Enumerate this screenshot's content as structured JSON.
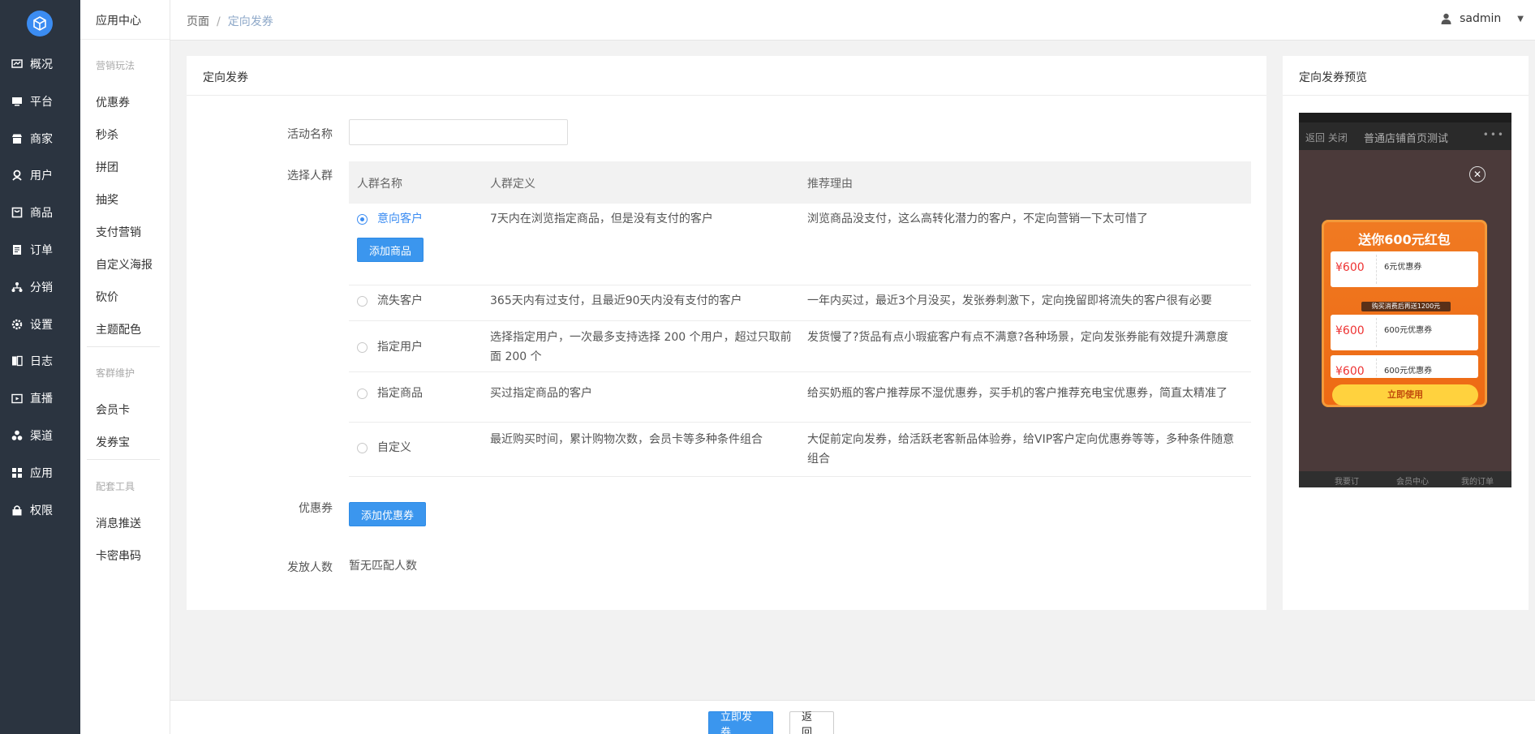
{
  "nav1": {
    "items": [
      {
        "label": "概况",
        "icon": "dashboard-icon"
      },
      {
        "label": "平台",
        "icon": "monitor-icon"
      },
      {
        "label": "商家",
        "icon": "store-icon"
      },
      {
        "label": "用户",
        "icon": "user-icon"
      },
      {
        "label": "商品",
        "icon": "goods-icon"
      },
      {
        "label": "订单",
        "icon": "order-icon"
      },
      {
        "label": "分销",
        "icon": "distribution-icon"
      },
      {
        "label": "设置",
        "icon": "gear-icon"
      },
      {
        "label": "日志",
        "icon": "log-icon"
      },
      {
        "label": "直播",
        "icon": "live-icon"
      },
      {
        "label": "渠道",
        "icon": "channel-icon"
      },
      {
        "label": "应用",
        "icon": "apps-icon"
      },
      {
        "label": "权限",
        "icon": "lock-icon"
      }
    ]
  },
  "nav2": {
    "title": "应用中心",
    "groups": [
      {
        "title": "营销玩法",
        "items": [
          "优惠券",
          "秒杀",
          "拼团",
          "抽奖",
          "支付营销",
          "自定义海报",
          "砍价",
          "主题配色"
        ]
      },
      {
        "title": "客群维护",
        "items": [
          "会员卡",
          "发券宝"
        ]
      },
      {
        "title": "配套工具",
        "items": [
          "消息推送",
          "卡密串码"
        ]
      }
    ]
  },
  "topbar": {
    "crumb_root": "页面",
    "crumb_sep": "/",
    "crumb_current": "定向发券",
    "username": "sadmin"
  },
  "form": {
    "title": "定向发券",
    "activity_name_label": "活动名称",
    "activity_name_value": "",
    "crowd_label": "选择人群",
    "coupon_label": "优惠券",
    "count_label": "发放人数",
    "count_value": "暂无匹配人数",
    "add_coupon_button": "添加优惠券",
    "add_goods_button": "添加商品"
  },
  "crowd_table": {
    "headers": [
      "人群名称",
      "人群定义",
      "推荐理由"
    ],
    "rows": [
      {
        "name": "意向客户",
        "definition": "7天内在浏览指定商品，但是没有支付的客户",
        "reason": "浏览商品没支付，这么高转化潜力的客户，不定向营销一下太可惜了",
        "selected": true
      },
      {
        "name": "流失客户",
        "definition": "365天内有过支付，且最近90天内没有支付的客户",
        "reason": "一年内买过，最近3个月没买，发张券刺激下，定向挽留即将流失的客户很有必要",
        "selected": false
      },
      {
        "name": "指定用户",
        "definition": "选择指定用户，一次最多支持选择 200 个用户，超过只取前面 200 个",
        "reason": "发货慢了?货品有点小瑕疵客户有点不满意?各种场景，定向发张券能有效提升满意度",
        "selected": false
      },
      {
        "name": "指定商品",
        "definition": "买过指定商品的客户",
        "reason": "给买奶瓶的客户推荐尿不湿优惠券，买手机的客户推荐充电宝优惠券，简直太精准了",
        "selected": false
      },
      {
        "name": "自定义",
        "definition": "最近购买时间，累计购物次数，会员卡等多种条件组合",
        "reason": "大促前定向发券，给活跃老客新品体验券，给VIP客户定向优惠券等等，多种条件随意组合",
        "selected": false
      }
    ]
  },
  "preview": {
    "title": "定向发券预览",
    "phone_title": "普通店铺首页测试",
    "phone_back": "返回  关闭",
    "popup_title": "送你600元红包",
    "popup_badge": "购买消费后再送1200元",
    "popup_button": "立即使用",
    "coupons": [
      {
        "value": "¥600",
        "name": "6元优惠券"
      },
      {
        "value": "¥600",
        "name": "600元优惠券"
      },
      {
        "value": "¥600",
        "name": "600元优惠券"
      }
    ],
    "footer_tabs": [
      "我要订",
      "会员中心",
      "我的订单"
    ]
  },
  "footer": {
    "submit_button": "立即发券",
    "back_button": "返回"
  },
  "colors": {
    "nav_bg": "#2b3440",
    "primary": "#3b96ee",
    "active_text": "#3b8cf2"
  }
}
